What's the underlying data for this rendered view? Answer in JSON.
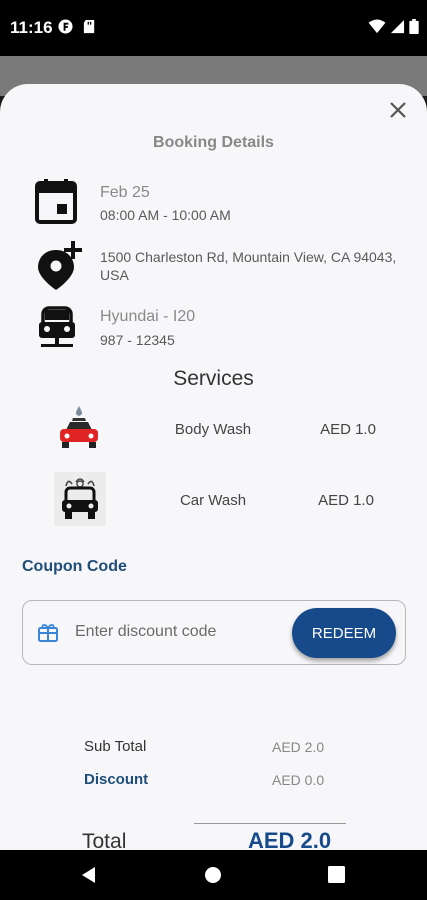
{
  "status_bar": {
    "time": "11:16"
  },
  "sheet": {
    "title": "Booking Details",
    "date": "Feb 25",
    "time_range": "08:00 AM - 10:00 AM",
    "address": "1500 Charleston Rd, Mountain View, CA 94043, USA",
    "vehicle_model": "Hyundai - I20",
    "vehicle_plate": "987 - 12345",
    "services_title": "Services",
    "services": [
      {
        "name": "Body Wash",
        "price": "AED 1.0"
      },
      {
        "name": "Car Wash",
        "price": "AED 1.0"
      }
    ],
    "coupon": {
      "label": "Coupon Code",
      "placeholder": "Enter discount code",
      "value": "",
      "button": "REDEEM"
    },
    "summary": {
      "subtotal_label": "Sub Total",
      "subtotal_value": "AED 2.0",
      "discount_label": "Discount",
      "discount_value": "AED 0.0",
      "total_label": "Total",
      "total_value": "AED 2.0"
    }
  },
  "icons": {
    "calendar": "calendar-icon",
    "location": "add-location-icon",
    "car": "car-icon",
    "body_wash": "body-wash-icon",
    "car_wash": "car-wash-icon",
    "gift": "gift-icon",
    "close": "close-icon"
  },
  "colors": {
    "accent": "#164a8a",
    "coupon_label": "#1f4e79",
    "sheet_bg": "#f7f7f9",
    "status_bar": "#000000"
  }
}
